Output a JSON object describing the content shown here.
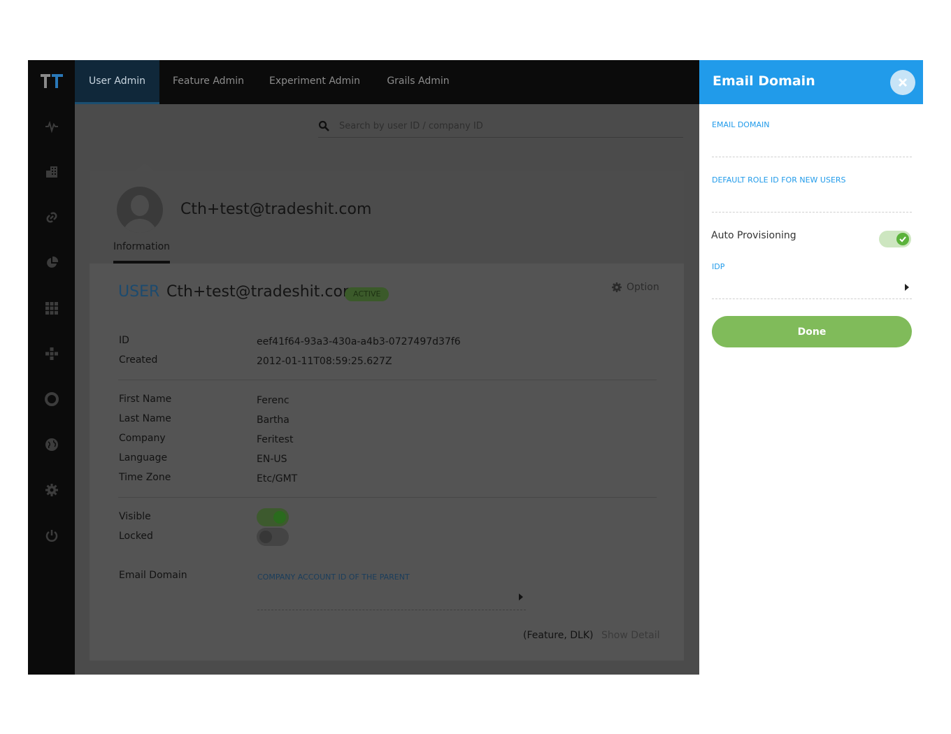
{
  "nav": {
    "tabs": [
      {
        "label": "User Admin",
        "active": true
      },
      {
        "label": "Feature Admin",
        "active": false
      },
      {
        "label": "Experiment Admin",
        "active": false
      },
      {
        "label": "Grails Admin",
        "active": false
      }
    ]
  },
  "sidebar": {
    "icons": [
      "pulse-icon",
      "building-icon",
      "link-icon",
      "pie-chart-icon",
      "grid-icon",
      "dots-cross-icon",
      "lifebuoy-icon",
      "globe-icon",
      "gear-icon",
      "power-icon"
    ]
  },
  "search": {
    "placeholder": "Search by user ID / company ID"
  },
  "profile": {
    "name": "Cth+test@tradeshit.com",
    "tab": "Information",
    "heading": "USER",
    "email": "Cth+test@tradeshit.com",
    "status": "ACTIVE",
    "option_label": "Option",
    "fields": {
      "id_label": "ID",
      "id_value": "eef41f64-93a3-430a-a4b3-0727497d37f6",
      "created_label": "Created",
      "created_value": "2012-01-11T08:59:25.627Z",
      "first_name_label": "First Name",
      "first_name_value": "Ferenc",
      "last_name_label": "Last Name",
      "last_name_value": "Bartha",
      "company_label": "Company",
      "company_value": "Feritest",
      "language_label": "Language",
      "language_value": "EN-US",
      "timezone_label": "Time Zone",
      "timezone_value": "Etc/GMT",
      "visible_label": "Visible",
      "visible_on": true,
      "locked_label": "Locked",
      "locked_on": false,
      "email_domain_label": "Email Domain",
      "parent_account_caption": "COMPANY ACCOUNT ID OF THE PARENT"
    },
    "feature_text": "(Feature, DLK)",
    "show_detail": "Show Detail"
  },
  "panel": {
    "title": "Email Domain",
    "email_domain_label": "EMAIL DOMAIN",
    "email_domain_value": "",
    "default_role_label": "DEFAULT ROLE ID FOR NEW USERS",
    "default_role_value": "",
    "auto_provisioning_label": "Auto Provisioning",
    "auto_provisioning_on": true,
    "idp_label": "IDP",
    "done_label": "Done"
  },
  "colors": {
    "accent": "#219bea",
    "done": "#80bb5a",
    "toggle_on": "#5bb33b"
  }
}
